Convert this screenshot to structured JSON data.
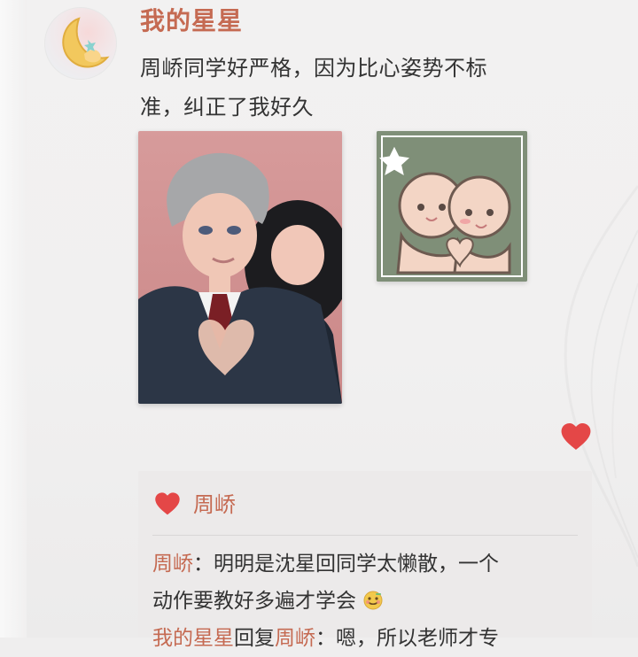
{
  "post": {
    "username": "我的星星",
    "content_line1": "周峤同学好严格，因为比心姿势不标",
    "content_line2": "准，纠正了我好久"
  },
  "likes": {
    "user": "周峤"
  },
  "comments": [
    {
      "name": "周峤",
      "sep": "：",
      "text_line1": "明明是沈星回同学太懒散，一个",
      "text_line2": "动作要教好多遍才学会"
    },
    {
      "name": "我的星星",
      "reply_word": "回复",
      "reply_to": "周峤",
      "sep": "：",
      "text": "嗯，所以老师才专"
    }
  ],
  "colors": {
    "accent": "#c56a52",
    "heart": "#e44747",
    "text": "#333333",
    "comment_bg": "#eceaea"
  },
  "icons": {
    "like": "heart-icon",
    "emoji": "smile-emoji-icon"
  }
}
